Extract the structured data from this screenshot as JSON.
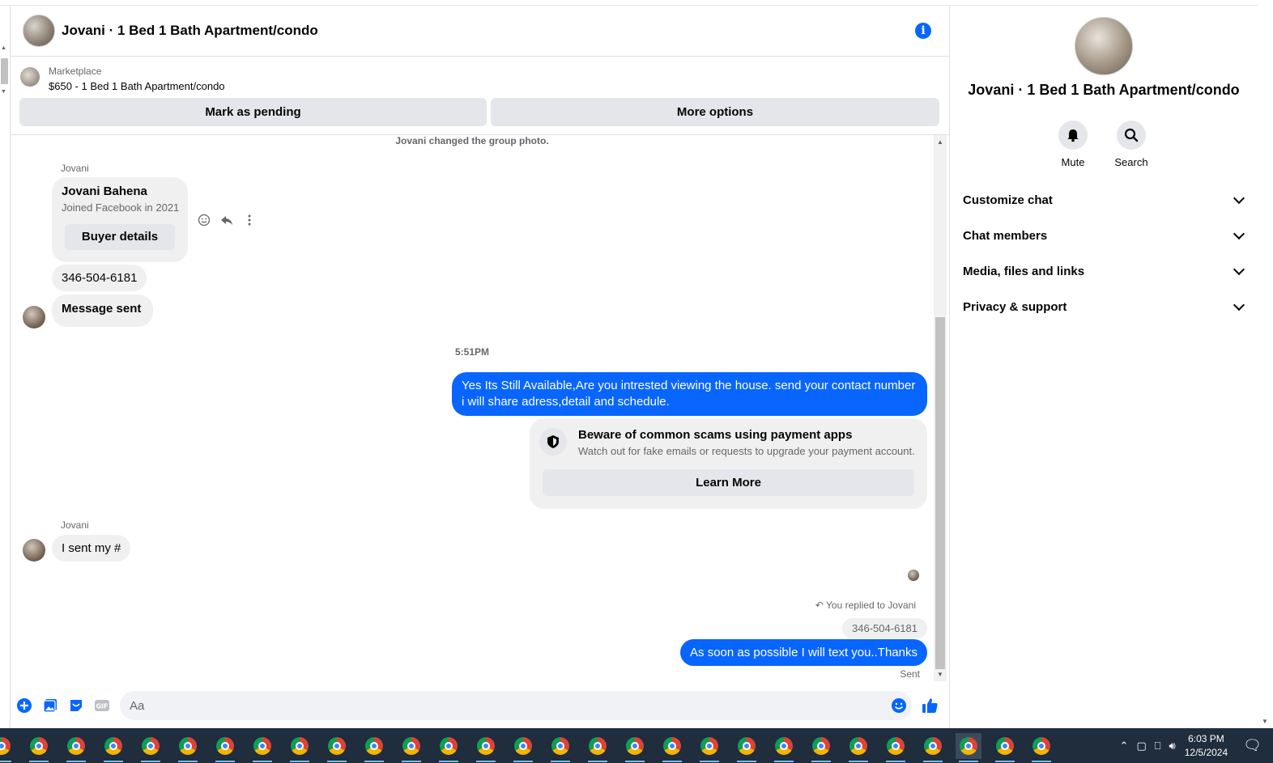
{
  "header": {
    "title": "Jovani · 1 Bed 1 Bath Apartment/condo",
    "info_icon": "i"
  },
  "marketplace": {
    "label": "Marketplace",
    "listing": "$650 - 1 Bed 1 Bath Apartment/condo",
    "mark_pending": "Mark as pending",
    "more_options": "More options"
  },
  "conversation": {
    "system_note": "Jovani changed the group photo.",
    "sender_1": "Jovani",
    "buyer_card": {
      "name": "Jovani Bahena",
      "joined": "Joined Facebook in 2021",
      "button": "Buyer details"
    },
    "msg_phone": "346-504-6181",
    "msg_sent": "Message sent",
    "timestamp": "5:51PM",
    "out_msg_1": "Yes Its Still Available,Are you intrested viewing the house. send your contact number i will share adress,detail and schedule.",
    "scam": {
      "title": "Beware of common scams using payment apps",
      "desc": "Watch out for fake emails or requests to upgrade your payment account.",
      "button": "Learn More"
    },
    "sender_2": "Jovani",
    "in_msg_2": "I sent my #",
    "replied_note": "You replied to Jovani",
    "replied_quote": "346-504-6181",
    "out_msg_2": "As soon as possible I will text you..Thanks",
    "status": "Sent"
  },
  "composer": {
    "placeholder": "Aa"
  },
  "right_panel": {
    "title": "Jovani · 1 Bed 1 Bath Apartment/condo",
    "mute_label": "Mute",
    "search_label": "Search",
    "sections": [
      "Customize chat",
      "Chat members",
      "Media, files and links",
      "Privacy & support"
    ]
  },
  "taskbar": {
    "time": "6:03 PM",
    "date": "12/5/2024"
  },
  "colors": {
    "accent": "#0866ff",
    "bubble_in": "#f0f0f0",
    "taskbar": "#1f2d3d"
  }
}
